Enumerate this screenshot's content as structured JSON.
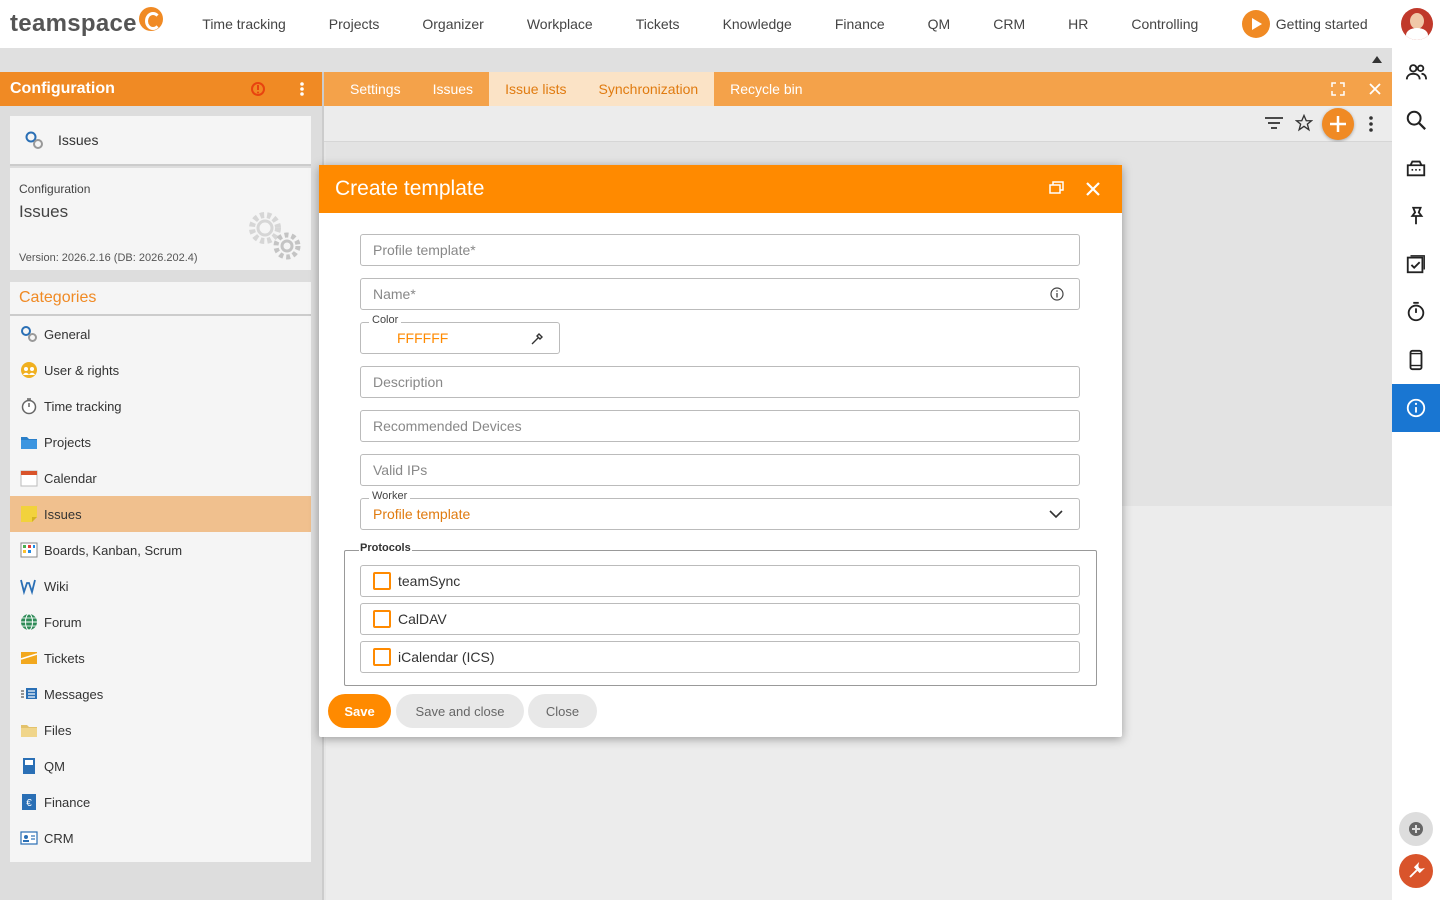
{
  "topnav": {
    "logo": "teamspace",
    "items": [
      "Time tracking",
      "Projects",
      "Organizer",
      "Workplace",
      "Tickets",
      "Knowledge",
      "Finance",
      "QM",
      "CRM",
      "HR",
      "Controlling"
    ],
    "getting_started": "Getting started"
  },
  "leftpanel": {
    "header": "Configuration",
    "issues_card": "Issues",
    "config_label": "Configuration",
    "config_title": "Issues",
    "version": "Version: 2026.2.16 (DB: 2026.202.4)",
    "categories_title": "Categories",
    "categories": [
      {
        "label": "General",
        "icon": "gears-icon"
      },
      {
        "label": "User & rights",
        "icon": "users-icon"
      },
      {
        "label": "Time tracking",
        "icon": "stopwatch-icon"
      },
      {
        "label": "Projects",
        "icon": "folder-icon"
      },
      {
        "label": "Calendar",
        "icon": "calendar-icon"
      },
      {
        "label": "Issues",
        "icon": "sticky-note-icon",
        "selected": true
      },
      {
        "label": "Boards, Kanban, Scrum",
        "icon": "board-icon"
      },
      {
        "label": "Wiki",
        "icon": "wiki-icon"
      },
      {
        "label": "Forum",
        "icon": "globe-icon"
      },
      {
        "label": "Tickets",
        "icon": "ticket-icon"
      },
      {
        "label": "Messages",
        "icon": "messages-icon"
      },
      {
        "label": "Files",
        "icon": "files-icon"
      },
      {
        "label": "QM",
        "icon": "qm-icon"
      },
      {
        "label": "Finance",
        "icon": "euro-icon"
      },
      {
        "label": "CRM",
        "icon": "contact-card-icon"
      }
    ]
  },
  "tabs": [
    {
      "label": "Settings",
      "active": false
    },
    {
      "label": "Issues",
      "active": false
    },
    {
      "label": "Issue lists",
      "active": false
    },
    {
      "label": "Synchronization",
      "active": true
    },
    {
      "label": "Recycle bin",
      "active": false
    }
  ],
  "dialog": {
    "title": "Create template",
    "fields": {
      "profile_template": "Profile template*",
      "name": "Name*",
      "color_label": "Color",
      "color_value": "FFFFFF",
      "description": "Description",
      "recommended_devices": "Recommended Devices",
      "valid_ips": "Valid IPs",
      "worker_label": "Worker",
      "worker_value": "Profile template"
    },
    "protocols_label": "Protocols",
    "protocols": [
      "teamSync",
      "CalDAV",
      "iCalendar (ICS)"
    ],
    "buttons": {
      "save": "Save",
      "save_and_close": "Save and close",
      "close": "Close"
    }
  },
  "colors": {
    "accent": "#ff8a00",
    "tab_bar": "#f4a24a",
    "header_orange": "#f08a24",
    "active_rail": "#1976d2",
    "selected_category": "#f0c08e"
  }
}
